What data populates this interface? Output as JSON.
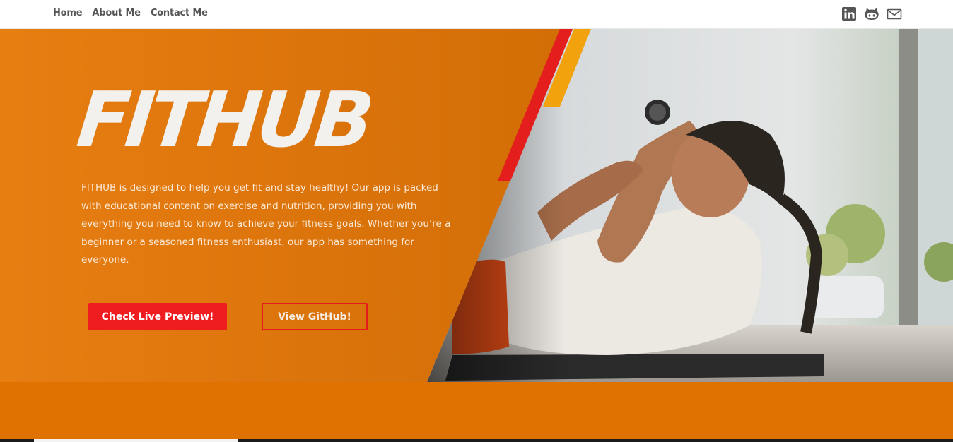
{
  "nav": {
    "links": [
      {
        "label": "Home"
      },
      {
        "label": "About Me"
      },
      {
        "label": "Contact Me"
      }
    ],
    "icons": [
      "linkedin-icon",
      "github-icon",
      "mail-icon"
    ],
    "icon_color": "#555555"
  },
  "hero": {
    "title": "FITHUB",
    "description": "FITHUB is designed to help you get fit and stay healthy! Our app is packed with educational content on exercise and nutrition, providing you with everything you need to know to achieve your fitness goals. Whether you’re a beginner or a seasoned fitness enthusiast, our app has something for everyone.",
    "primary_button": "Check Live Preview!",
    "secondary_button": "View GitHub!",
    "colors": {
      "orange": "#d9720a",
      "accent_red": "#f01d20",
      "accent_yellow": "#f2a20c"
    }
  }
}
